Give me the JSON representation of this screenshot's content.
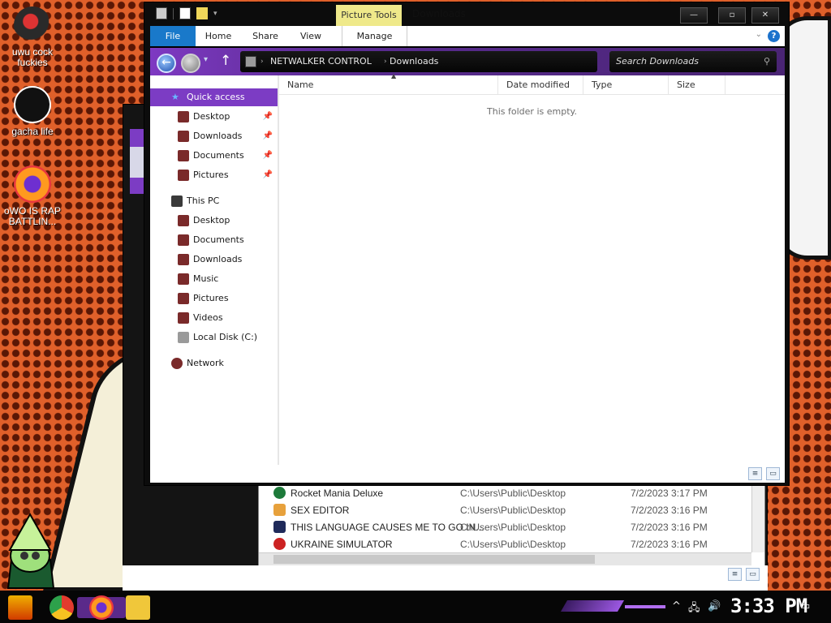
{
  "desktop": {
    "icons": [
      {
        "label": "uwu cock\nfuckies",
        "icon": "helmet-icon"
      },
      {
        "label": "gacha life",
        "icon": "spy-icon"
      },
      {
        "label": "oWO IS RAP\nBATTLIN...",
        "icon": "firefox-icon"
      }
    ]
  },
  "window": {
    "title": "Downloads",
    "context_tab": "Picture Tools",
    "controls": {
      "minimize": "—",
      "maximize": "▫",
      "close": "✕"
    },
    "ribbon": {
      "tabs": [
        "File",
        "Home",
        "Share",
        "View",
        "Manage"
      ],
      "help": "?"
    },
    "address": {
      "crumb_root": "NETWALKER CONTROL",
      "crumb_current": "Downloads",
      "search_placeholder": "Search Downloads"
    },
    "nav": {
      "quick_access": "Quick access",
      "quick_items": [
        "Desktop",
        "Downloads",
        "Documents",
        "Pictures"
      ],
      "this_pc": "This PC",
      "pc_items": [
        "Desktop",
        "Documents",
        "Downloads",
        "Music",
        "Pictures",
        "Videos",
        "Local Disk (C:)"
      ],
      "network": "Network"
    },
    "columns": [
      "Name",
      "Date modified",
      "Type",
      "Size"
    ],
    "empty_message": "This folder is empty."
  },
  "back_window": {
    "rows": [
      {
        "name": "Rocket Mania Deluxe",
        "path": "C:\\Users\\Public\\Desktop",
        "date": "7/2/2023 3:17 PM"
      },
      {
        "name": "SEX EDITOR",
        "path": "C:\\Users\\Public\\Desktop",
        "date": "7/2/2023 3:16 PM"
      },
      {
        "name": "THIS LANGUAGE CAUSES ME TO GO IN...",
        "path": "C:\\Users\\Public\\Desktop",
        "date": "7/2/2023 3:16 PM"
      },
      {
        "name": "UKRAINE SIMULATOR",
        "path": "C:\\Users\\Public\\Desktop",
        "date": "7/2/2023 3:16 PM"
      }
    ]
  },
  "taskbar": {
    "clock": "3:33 PM",
    "apps": [
      "chrome-icon",
      "firefox-icon",
      "file-explorer-icon"
    ]
  },
  "colors": {
    "accent": "#7c3cc4",
    "file_tab": "#1979ca",
    "picture_tools": "#efe98a"
  }
}
